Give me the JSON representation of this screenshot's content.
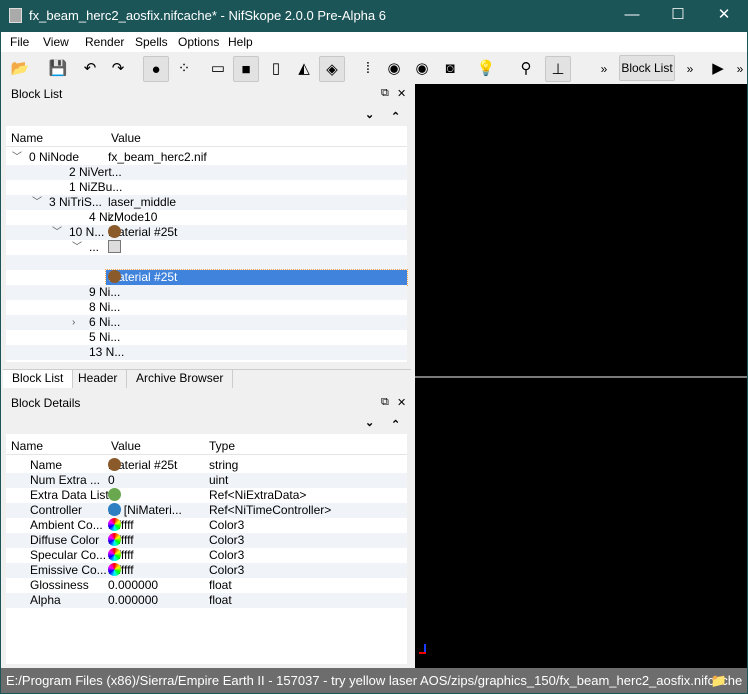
{
  "window": {
    "title": "fx_beam_herc2_aosfix.nifcache* - NifSkope 2.0.0 Pre-Alpha 6",
    "minimize": "—",
    "maximize": "☐",
    "close": "✕"
  },
  "menu": [
    "File",
    "View",
    "Render",
    "Spells",
    "Options",
    "Help"
  ],
  "toolbar": {
    "icons": [
      {
        "name": "open-icon",
        "glyph": "📂"
      },
      {
        "name": "save-icon",
        "glyph": "💾"
      },
      {
        "name": "undo-icon",
        "glyph": "↶"
      },
      {
        "name": "redo-icon",
        "glyph": "↷"
      },
      {
        "name": "select-object-icon",
        "glyph": "●"
      },
      {
        "name": "select-vertex-icon",
        "glyph": "⁘"
      },
      {
        "name": "view-wireframe-icon",
        "glyph": "▭"
      },
      {
        "name": "view-solid-icon",
        "glyph": "■"
      },
      {
        "name": "view-textured-icon",
        "glyph": "▯"
      },
      {
        "name": "view-normals-icon",
        "glyph": "◭"
      },
      {
        "name": "view-color-icon",
        "glyph": "◈"
      },
      {
        "name": "footprints-icon",
        "glyph": "⁞"
      },
      {
        "name": "eye-icon",
        "glyph": "◉"
      },
      {
        "name": "eye-edit-icon",
        "glyph": "◉"
      },
      {
        "name": "screenshot-icon",
        "glyph": "◙"
      },
      {
        "name": "lightbulb-icon",
        "glyph": "💡"
      },
      {
        "name": "light-direction-icon",
        "glyph": "⚲"
      },
      {
        "name": "axes-icon",
        "glyph": "⊥"
      }
    ],
    "overflow": "»",
    "block_list_label": "Block List",
    "play": "▶"
  },
  "block_list": {
    "title": "Block List",
    "float": "⧉",
    "close": "✕",
    "expand": "⌄",
    "collapse": "⌃",
    "columns": [
      "Name",
      "Value"
    ],
    "rows": [
      {
        "name": "0 NiNode",
        "value": "fx_beam_herc2.nif",
        "level": 0,
        "chev": "v"
      },
      {
        "name": "2 NiVert...",
        "value": "",
        "level": 2
      },
      {
        "name": "1 NiZBu...",
        "value": "",
        "level": 2
      },
      {
        "name": "3 NiTriS...",
        "value": "laser_middle",
        "level": 1,
        "chev": "v"
      },
      {
        "name": "4 Ni...",
        "value": " zMode10",
        "level": 3
      },
      {
        "name": "10 N...",
        "value": "Material #25t",
        "level": 2,
        "chev": "v",
        "icon": "palette"
      },
      {
        "name": "...",
        "value": "",
        "level": 3,
        "chev": "v",
        "icon": "flag"
      },
      {
        "name": "",
        "value": "",
        "level": 0
      },
      {
        "name": "",
        "value": "Material #25t",
        "level": 0,
        "icon": "palette",
        "selected": true
      },
      {
        "name": "9 Ni...",
        "value": "",
        "level": 3
      },
      {
        "name": "8 Ni...",
        "value": "",
        "level": 3
      },
      {
        "name": "6 Ni...",
        "value": "",
        "level": 3,
        "chev": ">"
      },
      {
        "name": "5 Ni...",
        "value": "",
        "level": 3
      },
      {
        "name": "13 N...",
        "value": "",
        "level": 3
      }
    ]
  },
  "tabs": [
    "Block List",
    "Header",
    "Archive Browser"
  ],
  "block_details": {
    "title": "Block Details",
    "columns": [
      "Name",
      "Value",
      "Type"
    ],
    "rows": [
      {
        "name": "Name",
        "value": "Material #25t",
        "type": "string",
        "icon": "palette"
      },
      {
        "name": "Num Extra ...",
        "value": "0",
        "type": "uint"
      },
      {
        "name": "Extra Data List",
        "value": "",
        "type": "Ref<NiExtraData>",
        "icon": "refresh"
      },
      {
        "name": "Controller",
        "value": "11 [NiMateri...",
        "type": "Ref<NiTimeController>",
        "icon": "controller"
      },
      {
        "name": "Ambient Co...",
        "value": "#ffffff",
        "type": "Color3",
        "icon": "wheel"
      },
      {
        "name": "Diffuse Color",
        "value": "#ffffff",
        "type": "Color3",
        "icon": "wheel"
      },
      {
        "name": "Specular Co...",
        "value": "#ffffff",
        "type": "Color3",
        "icon": "wheel"
      },
      {
        "name": "Emissive Co...",
        "value": "#ffffff",
        "type": "Color3",
        "icon": "wheel"
      },
      {
        "name": "Glossiness",
        "value": "0.000000",
        "type": "float"
      },
      {
        "name": "Alpha",
        "value": "0.000000",
        "type": "float"
      }
    ]
  },
  "status": "E:/Program Files (x86)/Sierra/Empire Earth II - 157037 - try yellow laser AOS/zips/graphics_150/fx_beam_herc2_aosfix.nifcache",
  "colors": {
    "titlebar": "#1c5558",
    "selection": "#3f83dc",
    "viewport": "#000000",
    "statusbar": "#6d6d6d"
  }
}
